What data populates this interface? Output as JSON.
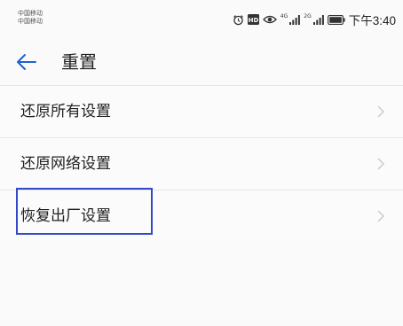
{
  "status_bar": {
    "carrier_1": "中国移动",
    "carrier_2": "中国移动",
    "network_1": "4G",
    "network_2": "2G",
    "clock": "下午3:40",
    "icons": [
      "alarm-icon",
      "hd-icon",
      "eye-icon",
      "signal-icon",
      "signal-icon",
      "battery-icon"
    ]
  },
  "header": {
    "title": "重置"
  },
  "list": {
    "items": [
      {
        "label": "还原所有设置"
      },
      {
        "label": "还原网络设置"
      },
      {
        "label": "恢复出厂设置"
      }
    ]
  },
  "colors": {
    "highlight": "#3348c9",
    "back_arrow": "#1e62d0"
  }
}
